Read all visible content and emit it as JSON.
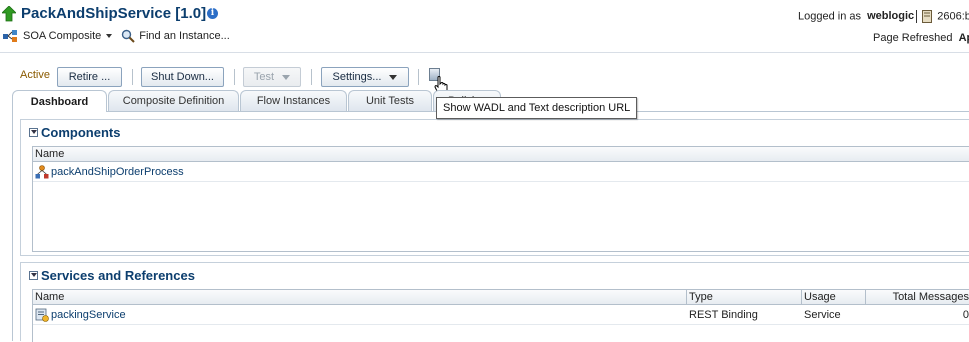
{
  "header": {
    "title": "PackAndShipService [1.0]",
    "menu_soa": "SOA Composite",
    "menu_find": "Find an Instance...",
    "logged_in_prefix": "Logged in as",
    "username": "weblogic",
    "host": "2606:b",
    "refreshed_prefix": "Page Refreshed",
    "refreshed_value": "Ap"
  },
  "toolbar": {
    "state": "Active",
    "retire_label": "Retire ...",
    "shutdown_label": "Shut Down...",
    "test_label": "Test",
    "settings_label": "Settings...",
    "wadl_icon": "wadl-document-icon"
  },
  "tooltip": {
    "text": "Show WADL and Text description URL"
  },
  "tabs": [
    {
      "label": "Dashboard",
      "active": true
    },
    {
      "label": "Composite Definition",
      "active": false
    },
    {
      "label": "Flow Instances",
      "active": false
    },
    {
      "label": "Unit Tests",
      "active": false
    },
    {
      "label": "Policies",
      "active": false
    }
  ],
  "components": {
    "title": "Components",
    "columns": [
      "Name"
    ],
    "rows": [
      {
        "name": "packAndShipOrderProcess",
        "icon": "bpel-process-icon"
      }
    ]
  },
  "services": {
    "title": "Services and References",
    "columns": [
      "Name",
      "Type",
      "Usage",
      "Total Messages"
    ],
    "rows": [
      {
        "name": "packingService",
        "type": "REST Binding",
        "usage": "Service",
        "total": "0",
        "icon": "rest-service-icon"
      }
    ]
  },
  "colors": {
    "title": "#0c3e6e",
    "state": "#8a5a00",
    "border": "#b9c6d3"
  }
}
